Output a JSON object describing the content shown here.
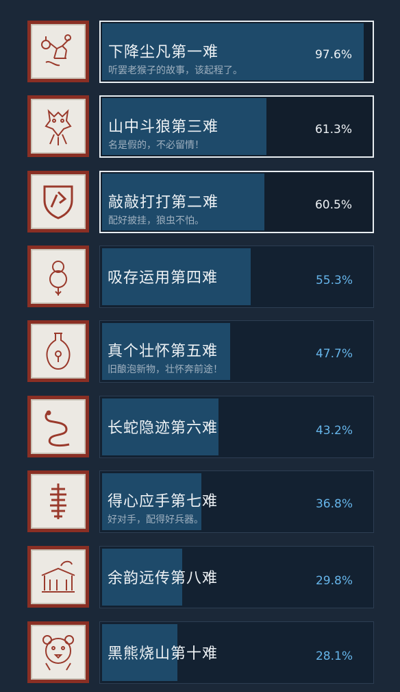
{
  "achievements": [
    {
      "title": "下降尘凡第一难",
      "description": "听罢老猴子的故事，该起程了。",
      "percent_label": "97.6%",
      "percent": 97.6,
      "unlocked": true,
      "icon": "monkey-icon"
    },
    {
      "title": "山中斗狼第三难",
      "description": "名是假的，不必留情！",
      "percent_label": "61.3%",
      "percent": 61.3,
      "unlocked": true,
      "icon": "wolf-icon"
    },
    {
      "title": "敲敲打打第二难",
      "description": "配好披挂，狼虫不怕。",
      "percent_label": "60.5%",
      "percent": 60.5,
      "unlocked": true,
      "icon": "shield-icon"
    },
    {
      "title": "吸存运用第四难",
      "description": "",
      "percent_label": "55.3%",
      "percent": 55.3,
      "unlocked": false,
      "icon": "gourd-icon"
    },
    {
      "title": "真个壮怀第五难",
      "description": "旧酿泡新物，壮怀奔前途！",
      "percent_label": "47.7%",
      "percent": 47.7,
      "unlocked": false,
      "icon": "vase-icon"
    },
    {
      "title": "长蛇隐迹第六难",
      "description": "",
      "percent_label": "43.2%",
      "percent": 43.2,
      "unlocked": false,
      "icon": "snake-icon"
    },
    {
      "title": "得心应手第七难",
      "description": "好对手，配得好兵器。",
      "percent_label": "36.8%",
      "percent": 36.8,
      "unlocked": false,
      "icon": "spine-icon"
    },
    {
      "title": "余韵远传第八难",
      "description": "",
      "percent_label": "29.8%",
      "percent": 29.8,
      "unlocked": false,
      "icon": "temple-icon"
    },
    {
      "title": "黑熊烧山第十难",
      "description": "",
      "percent_label": "28.1%",
      "percent": 28.1,
      "unlocked": false,
      "icon": "bear-icon"
    }
  ]
}
